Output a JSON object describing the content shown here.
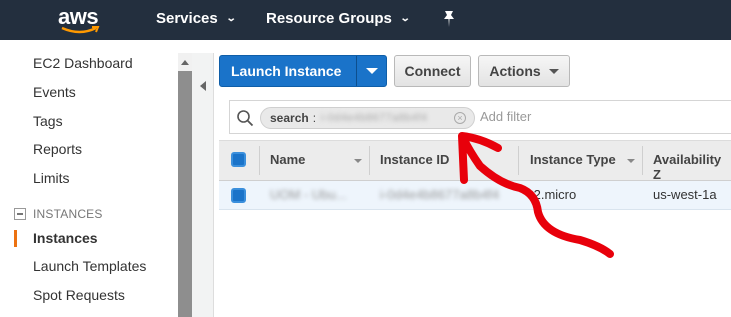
{
  "topnav": {
    "logo": "aws",
    "services_label": "Services",
    "resource_groups_label": "Resource Groups",
    "chevron": "⌄"
  },
  "sidebar": {
    "items": [
      {
        "label": "EC2 Dashboard"
      },
      {
        "label": "Events"
      },
      {
        "label": "Tags"
      },
      {
        "label": "Reports"
      },
      {
        "label": "Limits"
      }
    ],
    "section_title": "INSTANCES",
    "section_items": [
      {
        "label": "Instances",
        "active": true
      },
      {
        "label": "Launch Templates"
      },
      {
        "label": "Spot Requests"
      }
    ]
  },
  "toolbar": {
    "launch_label": "Launch Instance",
    "connect_label": "Connect",
    "actions_label": "Actions"
  },
  "search": {
    "chip_key": "search",
    "chip_sep": ":",
    "chip_value": "i-0d4e4b8677a8b4f4",
    "placeholder": "Add filter"
  },
  "table": {
    "columns": [
      "Name",
      "Instance ID",
      "Instance Type",
      "Availability Z"
    ],
    "rows": [
      {
        "name": "UOM - Ubu...",
        "instance_id": "i-0d4e4b8677a8b4f4",
        "type": "t2.micro",
        "az": "us-west-1a"
      }
    ]
  },
  "colors": {
    "nav_bg": "#232f3e",
    "primary": "#1a73c9",
    "accent": "#ec7211",
    "annotation": "#e8000b"
  }
}
